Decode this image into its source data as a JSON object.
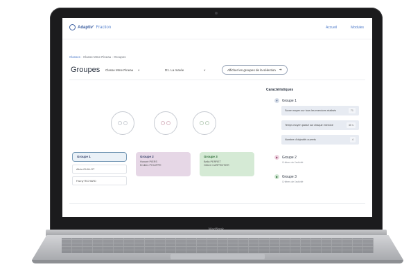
{
  "device": {
    "brand": "MacBook"
  },
  "app": {
    "logo_text": "Adaptiv'",
    "logo_accent": "Fraction",
    "nav": [
      "Accueil",
      "Modules"
    ]
  },
  "breadcrumb": {
    "root": "Classes",
    "separator": " · ",
    "current": "Classe Mme Pineau - Groupes"
  },
  "page_title": "Groupes",
  "filters": {
    "class_select": "Classe Mme Pineau",
    "activity_select": "D1. La marée",
    "show_button": "Afficher les groupes de la sélection"
  },
  "groups": [
    {
      "name": "Groupe 1",
      "members": []
    },
    {
      "name": "Groupe 2",
      "members": [
        "Honoré PIERS",
        "Emilien PHILIPPE"
      ]
    },
    {
      "name": "Groupe 3",
      "members": [
        "Bella PERRET",
        "Gilbert CARPENTIER"
      ]
    }
  ],
  "students_unassigned": [
    "Alicia GUILLOT",
    "Fanny RICHARD"
  ],
  "characteristics": {
    "title": "Caractéristiques",
    "group1": {
      "name": "Groupe 1",
      "criteria": [
        {
          "label": "Score moyen sur tous les exercices réalisés",
          "value": "71"
        },
        {
          "label": "Temps moyen passé sur chaque exercice",
          "value": "40 s"
        },
        {
          "label": "Nombre d'objectifs ouverts",
          "value": "4"
        }
      ]
    },
    "group2": {
      "name": "Groupe 2",
      "sub": "Critères de l'activité"
    },
    "group3": {
      "name": "Groupe 3",
      "sub": "Critères de l'activité"
    }
  },
  "colors": {
    "accent": "#4a78c9",
    "group1": "#eaf1f7",
    "group2": "#e6d7e6",
    "group3": "#d5ead5"
  },
  "icons": {
    "arrow": "arrow-right-icon",
    "chevron": "chevron-down-icon"
  }
}
